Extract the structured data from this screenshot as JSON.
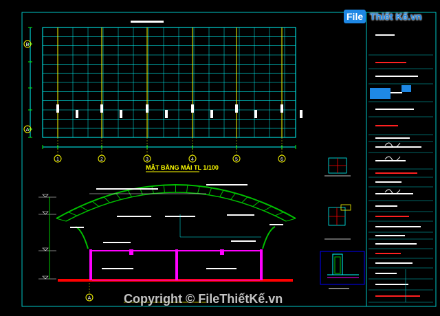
{
  "drawing": {
    "plan_title": "MẶT BẰNG MÁI TL 1/100",
    "grid_axes_horizontal": [
      "1",
      "2",
      "3",
      "4",
      "5",
      "6"
    ],
    "grid_axes_vertical": [
      "B",
      "A"
    ],
    "section_axis": "A"
  },
  "logo": {
    "file_label": "File",
    "rest_label": "Thiết Kế.vn"
  },
  "watermark": "Copyright © FileThiếtKế.vn",
  "colors": {
    "background": "#000000",
    "grid": "#00ffff",
    "purlin": "#ffff00",
    "truss": "#00c000",
    "column": "#ff00ff",
    "beam": "#ff0000",
    "text": "#ffffff",
    "dimension": "#00ff00",
    "frame": "#00c8c8",
    "red_text": "#ff2020"
  }
}
